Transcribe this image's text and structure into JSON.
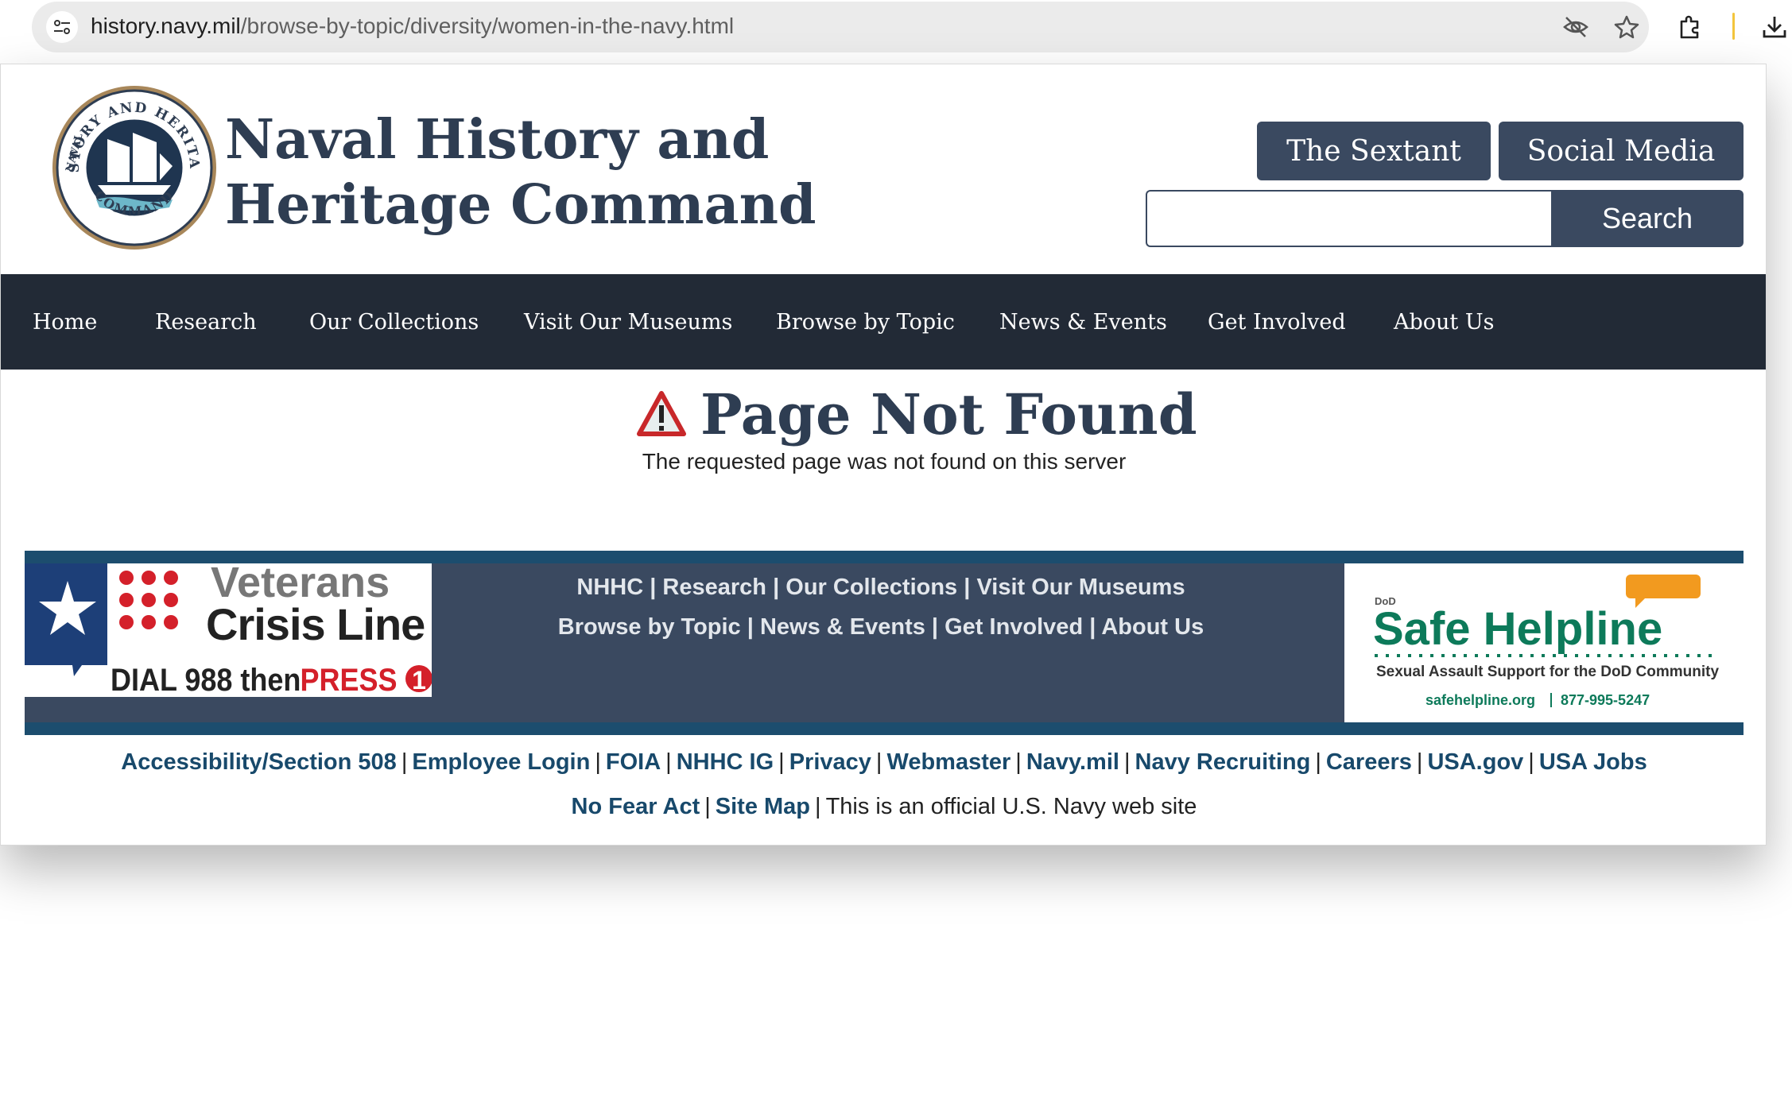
{
  "browser": {
    "url_host": "history.navy.mil",
    "url_path": "/browse-by-topic/diversity/women-in-the-navy.html"
  },
  "header": {
    "seal_text_top": "HISTORY AND HERITAGE",
    "seal_text_left": "NAVAL",
    "seal_text_bottom": "COMMAND",
    "title_line1": "Naval History and",
    "title_line2": "Heritage Command",
    "sextant_label": "The Sextant",
    "social_label": "Social Media",
    "search_value": "",
    "search_label": "Search"
  },
  "nav": {
    "items": [
      "Home",
      "Research",
      "Our Collections",
      "Visit Our Museums",
      "Browse by Topic",
      "News & Events",
      "Get Involved",
      "About Us"
    ]
  },
  "content": {
    "title": "Page Not Found",
    "subtitle": "The requested page was not found on this server"
  },
  "footer": {
    "vcl": {
      "line1": "Veterans",
      "line2": "Crisis Line",
      "dial": "DIAL 988 then",
      "press": "PRESS",
      "press_num": "1"
    },
    "row1": [
      "NHHC",
      "Research",
      "Our Collections",
      "Visit Our Museums"
    ],
    "row2": [
      "Browse by Topic",
      "News & Events",
      "Get Involved",
      "About Us"
    ],
    "separator": "|",
    "shl": {
      "dod": "DoD",
      "name": "Safe Helpline",
      "tagline": "Sexual Assault Support for the DoD Community",
      "site": "safehelpline.org",
      "phone": "877-995-5247"
    },
    "bottom_row1": [
      "Accessibility/Section 508",
      "Employee Login",
      "FOIA",
      "NHHC IG",
      "Privacy",
      "Webmaster",
      "Navy.mil",
      "Navy Recruiting",
      "Careers",
      "USA.gov",
      "USA Jobs"
    ],
    "bottom_row2": [
      "No Fear Act",
      "Site Map"
    ],
    "official_text": "This is an official U.S. Navy web site"
  },
  "colors": {
    "navy_dark": "#222a36",
    "slate": "#3a4960",
    "title": "#2e3d52",
    "link": "#18496b",
    "helpline_green": "#0d7a5a",
    "crisis_red": "#d4202a"
  }
}
